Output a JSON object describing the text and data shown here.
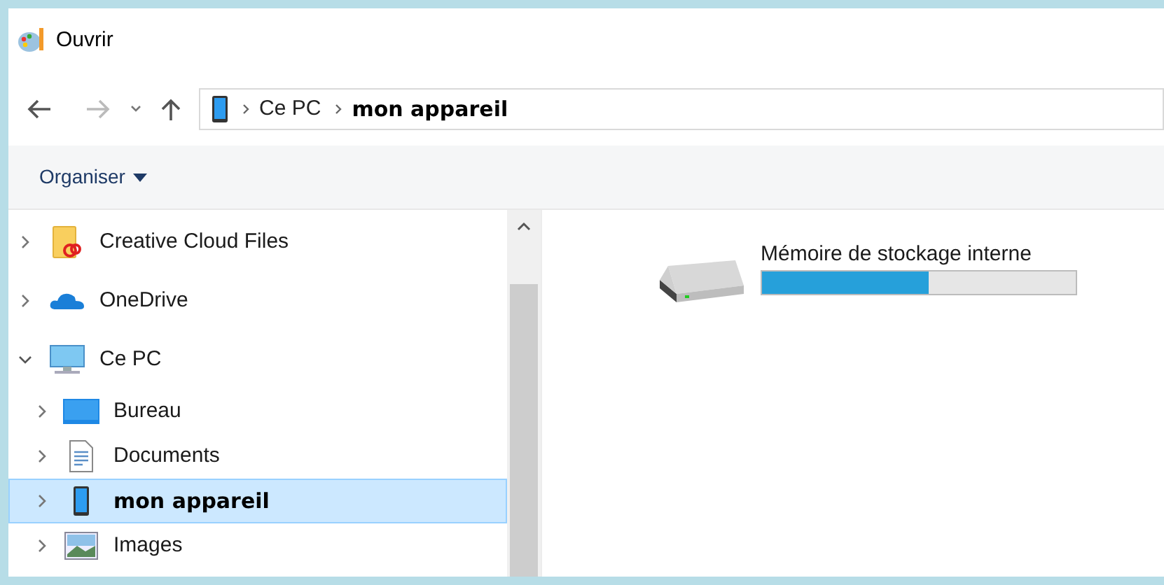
{
  "window": {
    "title": "Ouvrir"
  },
  "address_bar": {
    "crumbs": [
      {
        "label": "Ce PC",
        "current": false
      },
      {
        "label": "mon appareil",
        "current": true
      }
    ]
  },
  "toolbar": {
    "organise": "Organiser"
  },
  "tree": [
    {
      "label": "Creative Cloud Files",
      "kind": "cloud-folder",
      "expanded": false,
      "selected": false
    },
    {
      "label": "OneDrive",
      "kind": "onedrive",
      "expanded": false,
      "selected": false
    },
    {
      "label": "Ce PC",
      "kind": "pc",
      "expanded": true,
      "selected": false,
      "children": [
        {
          "label": "Bureau",
          "kind": "desktop",
          "expanded": false,
          "selected": false
        },
        {
          "label": "Documents",
          "kind": "documents",
          "expanded": false,
          "selected": false
        },
        {
          "label": "mon appareil",
          "kind": "phone",
          "expanded": false,
          "selected": true
        },
        {
          "label": "Images",
          "kind": "images",
          "expanded": false,
          "selected": false
        }
      ]
    }
  ],
  "drives": [
    {
      "name": "Mémoire de stockage interne",
      "level": 0.53
    }
  ]
}
